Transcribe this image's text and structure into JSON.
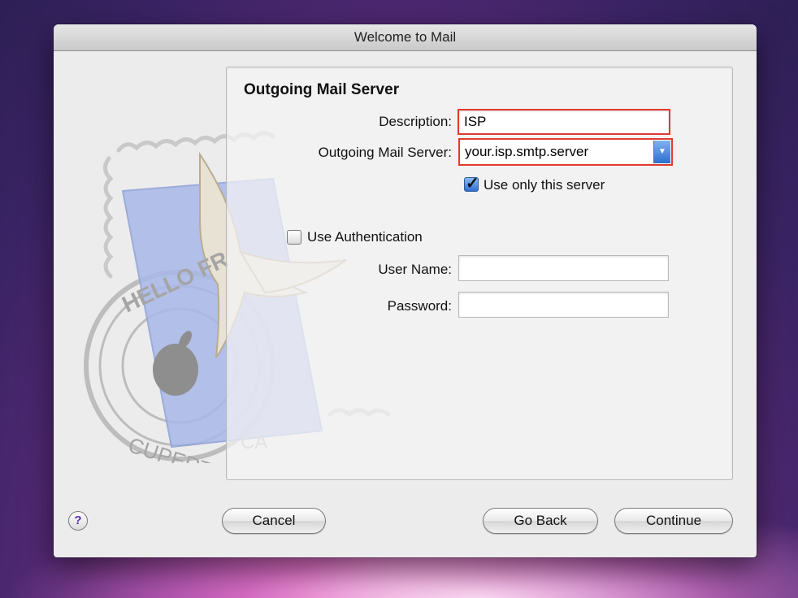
{
  "window": {
    "title": "Welcome to Mail"
  },
  "section": {
    "title": "Outgoing Mail Server"
  },
  "form": {
    "description_label": "Description:",
    "description_value": "ISP",
    "server_label": "Outgoing Mail Server:",
    "server_value": "your.isp.smtp.server",
    "use_only_label": "Use only this server",
    "use_only_checked": true,
    "use_auth_label": "Use Authentication",
    "use_auth_checked": false,
    "username_label": "User Name:",
    "username_value": "",
    "password_label": "Password:",
    "password_value": ""
  },
  "buttons": {
    "help": "?",
    "cancel": "Cancel",
    "go_back": "Go Back",
    "continue": "Continue"
  },
  "stamp": {
    "top_text": "HELLO FR",
    "bottom_text": "CUPERTINO",
    "side_text": "CA"
  },
  "colors": {
    "error_border": "#e2392f",
    "accent": "#2c6fd1"
  }
}
